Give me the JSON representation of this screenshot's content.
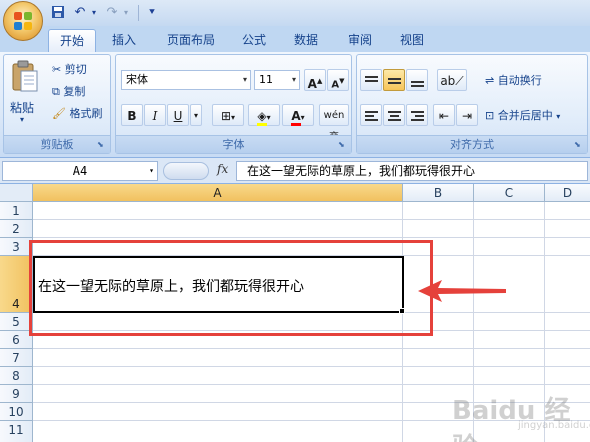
{
  "quick_access": {
    "save_icon": "save-icon",
    "undo_icon": "undo-icon",
    "redo_icon": "redo-icon",
    "customize_icon": "customize-icon"
  },
  "tabs": [
    {
      "label": "开始",
      "active": true
    },
    {
      "label": "插入"
    },
    {
      "label": "页面布局"
    },
    {
      "label": "公式"
    },
    {
      "label": "数据"
    },
    {
      "label": "审阅"
    },
    {
      "label": "视图"
    }
  ],
  "ribbon": {
    "clipboard": {
      "paste": "粘贴",
      "cut": "剪切",
      "copy": "复制",
      "format_painter": "格式刷",
      "label": "剪贴板"
    },
    "font": {
      "family": "宋体",
      "size": "11",
      "grow": "A",
      "shrink": "A",
      "bold": "B",
      "italic": "I",
      "underline": "U",
      "font_color": "A",
      "phonetic": "wén 变",
      "label": "字体"
    },
    "alignment": {
      "wrap_text": "自动换行",
      "merge_center": "合并后居中",
      "label": "对齐方式"
    }
  },
  "formula_bar": {
    "name_box": "A4",
    "fx": "fx",
    "formula": "在这一望无际的草原上，我们都玩得很开心"
  },
  "sheet": {
    "columns": [
      "A",
      "B",
      "C",
      "D"
    ],
    "selected_column": "A",
    "rows": [
      "1",
      "2",
      "3",
      "4",
      "5",
      "6",
      "7",
      "8",
      "9",
      "10",
      "11"
    ],
    "selected_row": "4",
    "cell_a4": "在这一望无际的草原上，我们都玩得很开心"
  },
  "watermark": {
    "text": "Baidu 经验",
    "sub": "jingyan.baidu.com"
  },
  "colors": {
    "accent": "#15428b",
    "annotation": "#e5413b",
    "selection": "#f1c15f"
  }
}
